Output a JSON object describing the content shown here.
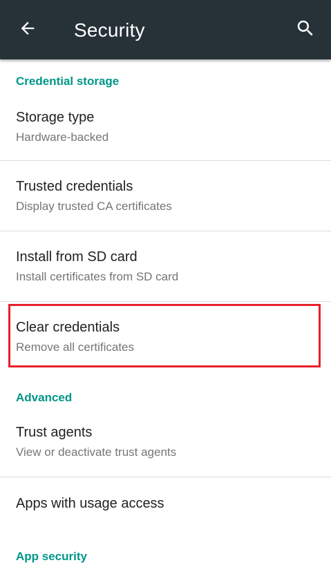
{
  "appbar": {
    "title": "Security",
    "back_icon": "arrow-back-icon",
    "search_icon": "search-icon",
    "background": "#263238"
  },
  "sections": [
    {
      "header": "Credential storage",
      "items": [
        {
          "title": "Storage type",
          "summary": "Hardware-backed"
        },
        {
          "title": "Trusted credentials",
          "summary": "Display trusted CA certificates"
        },
        {
          "title": "Install from SD card",
          "summary": "Install certificates from SD card"
        },
        {
          "title": "Clear credentials",
          "summary": "Remove all certificates"
        }
      ]
    },
    {
      "header": "Advanced",
      "items": [
        {
          "title": "Trust agents",
          "summary": "View or deactivate trust agents"
        },
        {
          "title": "Apps with usage access",
          "summary": ""
        }
      ]
    },
    {
      "header": "App security",
      "items": []
    }
  ],
  "colors": {
    "accent": "#009688",
    "highlight_box": "#e8202a"
  }
}
